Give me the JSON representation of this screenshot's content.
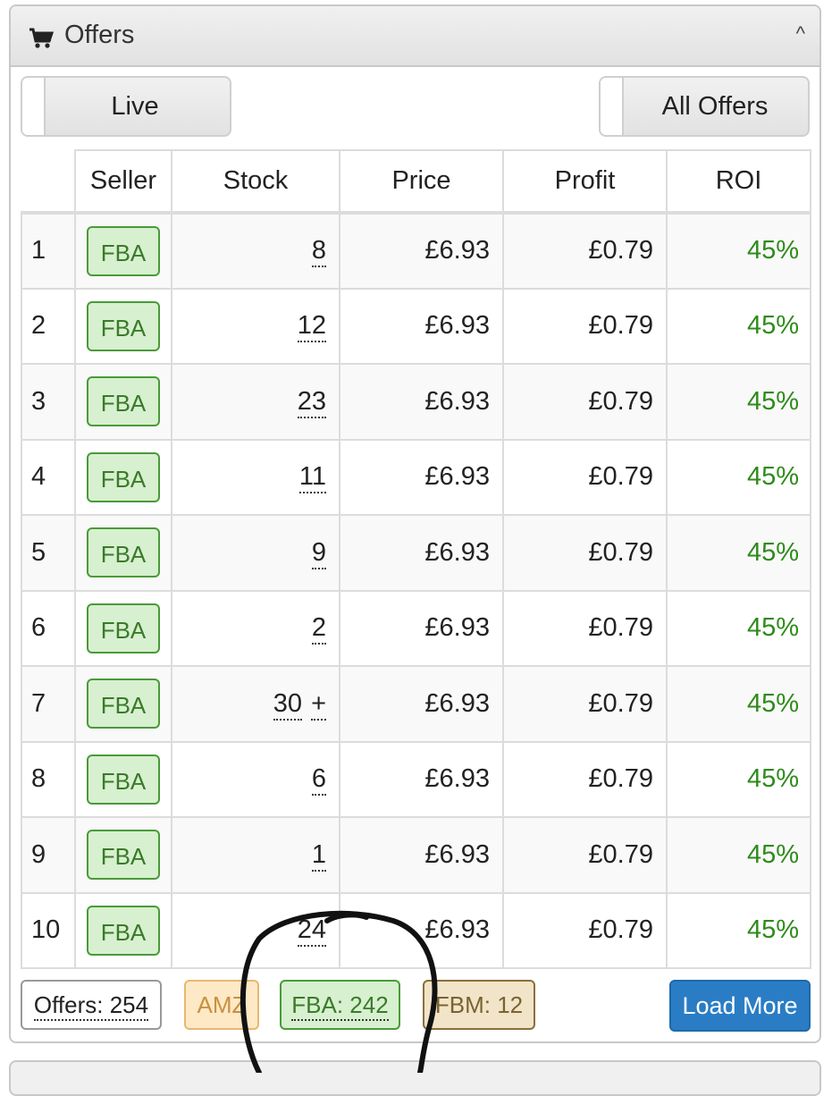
{
  "panel": {
    "title": "Offers",
    "icon": "cart-icon",
    "collapse_icon": "chevron-up-icon",
    "collapse_glyph": "^"
  },
  "toggles": {
    "live_label": "Live",
    "all_offers_label": "All Offers"
  },
  "table": {
    "headers": [
      "",
      "Seller",
      "Stock",
      "Price",
      "Profit",
      "ROI"
    ],
    "rows": [
      {
        "index": "1",
        "seller": "FBA",
        "stock": "8",
        "price": "£6.93",
        "profit": "£0.79",
        "roi": "45%"
      },
      {
        "index": "2",
        "seller": "FBA",
        "stock": "12",
        "price": "£6.93",
        "profit": "£0.79",
        "roi": "45%"
      },
      {
        "index": "3",
        "seller": "FBA",
        "stock": "23",
        "price": "£6.93",
        "profit": "£0.79",
        "roi": "45%"
      },
      {
        "index": "4",
        "seller": "FBA",
        "stock": "11",
        "price": "£6.93",
        "profit": "£0.79",
        "roi": "45%"
      },
      {
        "index": "5",
        "seller": "FBA",
        "stock": "9",
        "price": "£6.93",
        "profit": "£0.79",
        "roi": "45%"
      },
      {
        "index": "6",
        "seller": "FBA",
        "stock": "2",
        "price": "£6.93",
        "profit": "£0.79",
        "roi": "45%"
      },
      {
        "index": "7",
        "seller": "FBA",
        "stock": "30",
        "stock_suffix": "+",
        "price": "£6.93",
        "profit": "£0.79",
        "roi": "45%"
      },
      {
        "index": "8",
        "seller": "FBA",
        "stock": "6",
        "price": "£6.93",
        "profit": "£0.79",
        "roi": "45%"
      },
      {
        "index": "9",
        "seller": "FBA",
        "stock": "1",
        "price": "£6.93",
        "profit": "£0.79",
        "roi": "45%"
      },
      {
        "index": "10",
        "seller": "FBA",
        "stock": "24",
        "price": "£6.93",
        "profit": "£0.79",
        "roi": "45%"
      }
    ]
  },
  "footer": {
    "offers_count": "Offers: 254",
    "amz": "AMZ",
    "fba_count": "FBA: 242",
    "fbm_count": "FBM: 12",
    "load_more": "Load More"
  },
  "colors": {
    "roi_green": "#2e8b1a",
    "fba_badge_bg": "#d7f0cf",
    "load_more_blue": "#2a7dc4"
  }
}
